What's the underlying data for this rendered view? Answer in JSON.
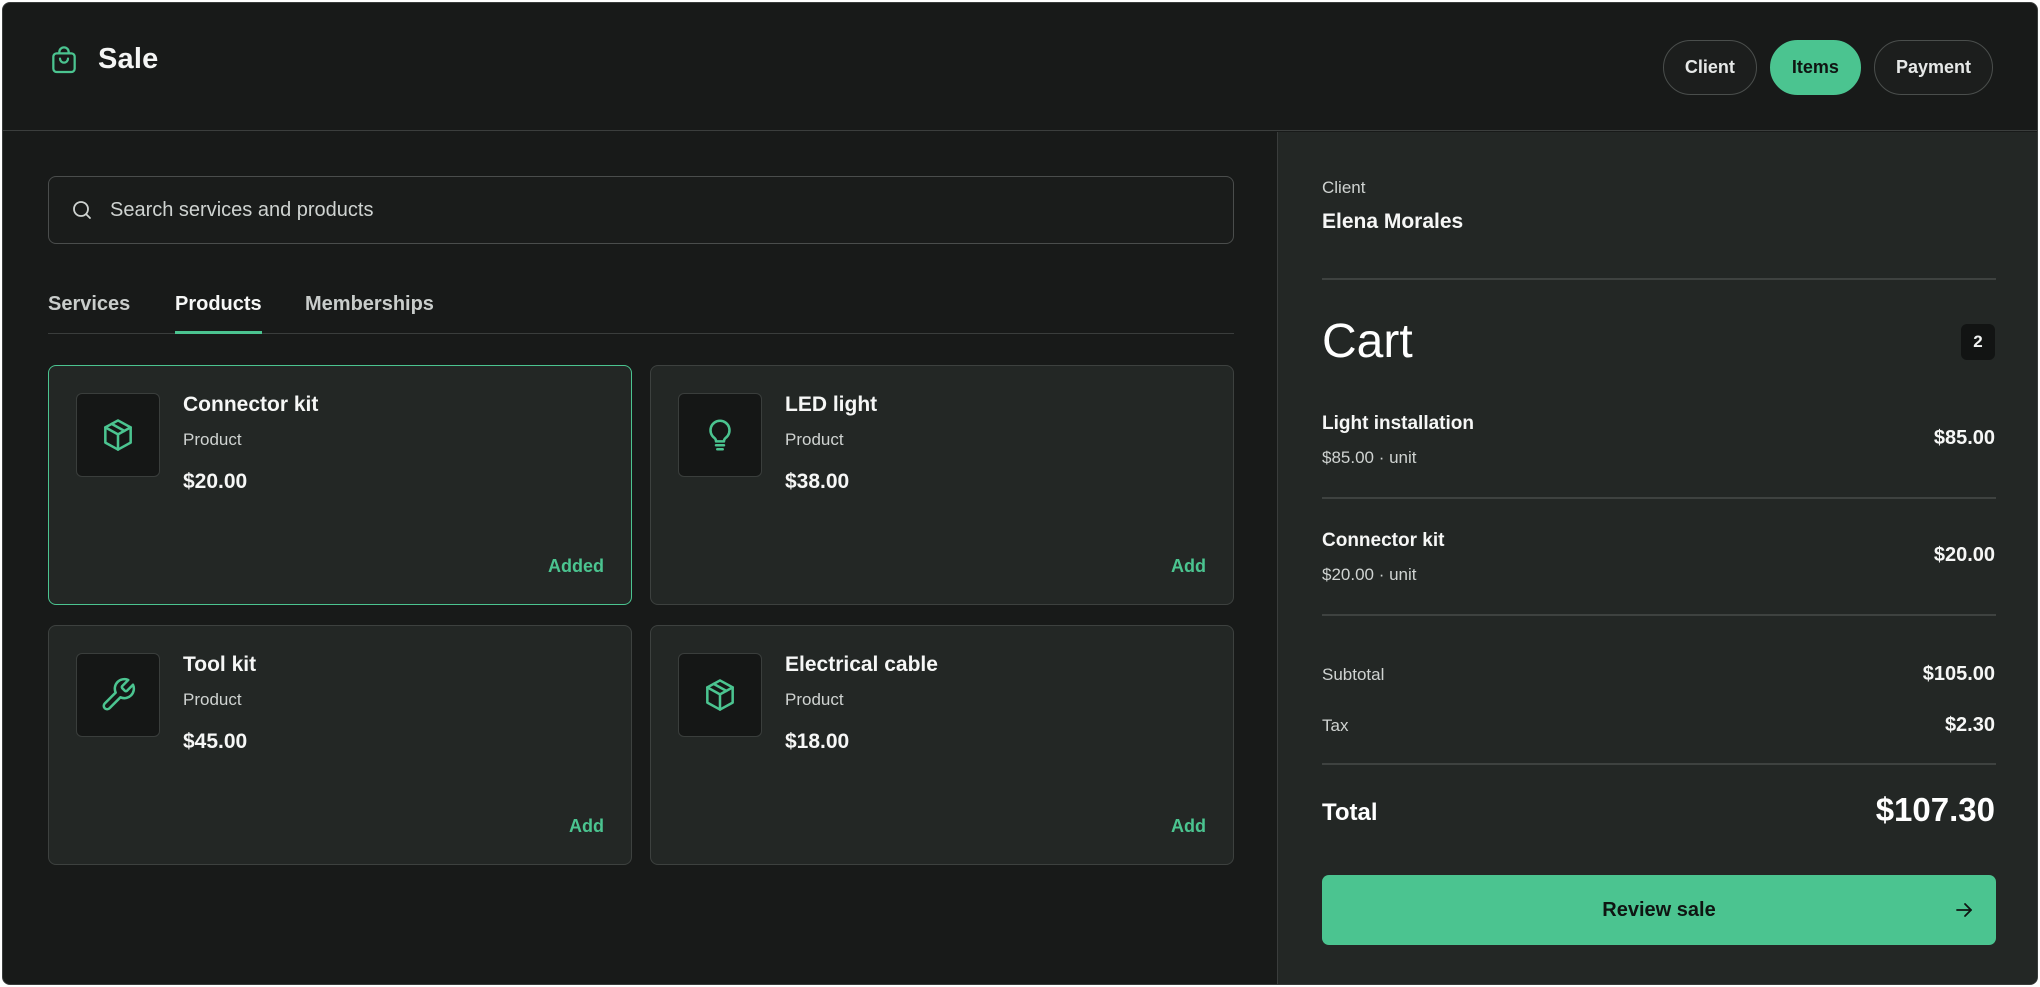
{
  "header": {
    "title": "Sale",
    "icon": "shopping-bag-icon",
    "steps": [
      {
        "label": "Client",
        "active": false
      },
      {
        "label": "Items",
        "active": true
      },
      {
        "label": "Payment",
        "active": false
      }
    ]
  },
  "search": {
    "placeholder": "Search services and products",
    "value": ""
  },
  "tabs": [
    {
      "label": "Services",
      "active": false
    },
    {
      "label": "Products",
      "active": true
    },
    {
      "label": "Memberships",
      "active": false
    }
  ],
  "products": [
    {
      "name": "Connector kit",
      "type": "Product",
      "price": "$20.00",
      "action": "Added",
      "icon": "box-icon",
      "selected": true
    },
    {
      "name": "LED light",
      "type": "Product",
      "price": "$38.00",
      "action": "Add",
      "icon": "lightbulb-icon",
      "selected": false
    },
    {
      "name": "Tool kit",
      "type": "Product",
      "price": "$45.00",
      "action": "Add",
      "icon": "wrench-icon",
      "selected": false
    },
    {
      "name": "Electrical cable",
      "type": "Product",
      "price": "$18.00",
      "action": "Add",
      "icon": "box-icon",
      "selected": false
    }
  ],
  "sidebar": {
    "client_label": "Client",
    "client_name": "Elena Morales",
    "cart_title": "Cart",
    "cart_count": "2",
    "items": [
      {
        "name": "Light installation",
        "unit": "$85.00 · unit",
        "total": "$85.00"
      },
      {
        "name": "Connector kit",
        "unit": "$20.00 · unit",
        "total": "$20.00"
      }
    ],
    "subtotal_label": "Subtotal",
    "subtotal": "$105.00",
    "tax_label": "Tax",
    "tax": "$2.30",
    "total_label": "Total",
    "total": "$107.30",
    "review_label": "Review sale",
    "review_icon": "arrow-right-icon"
  },
  "colors": {
    "accent": "#4bc490",
    "background": "#181a19",
    "panel": "#232725"
  }
}
